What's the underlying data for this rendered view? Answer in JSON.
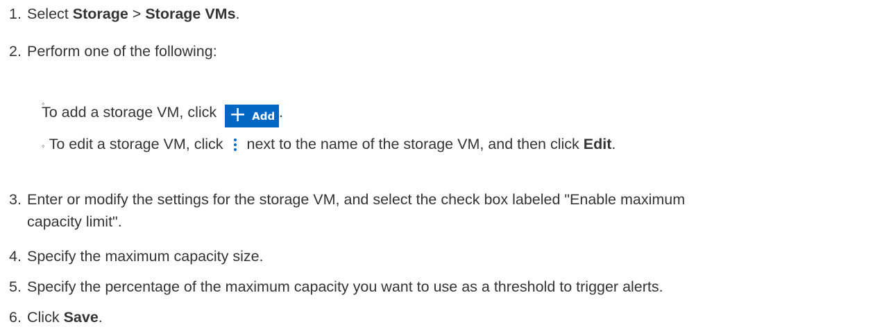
{
  "steps": [
    {
      "num": "1.",
      "pre": "Select ",
      "bold1": "Storage",
      "mid": " > ",
      "bold2": "Storage VMs",
      "post": "."
    },
    {
      "num": "2.",
      "text": "Perform one of the following:"
    },
    {
      "num": "3.",
      "line1": "Enter or modify the settings for the storage VM, and select the check box labeled \"Enable maximum",
      "line2": "capacity limit\"."
    },
    {
      "num": "4.",
      "text": "Specify the maximum capacity size."
    },
    {
      "num": "5.",
      "text": "Specify the percentage of the maximum capacity you want to use as a threshold to trigger alerts."
    },
    {
      "num": "6.",
      "pre": "Click ",
      "bold": "Save",
      "post": "."
    }
  ],
  "substeps": [
    {
      "bullet": "◦",
      "text": "To add a storage VM, click",
      "button": {
        "icon": "plus-icon",
        "label": "Add"
      },
      "post": "."
    },
    {
      "bullet": "◦",
      "pre": "To edit a storage VM, click",
      "icon": "kebab-menu-icon",
      "mid": "next to the name of the storage VM, and then click ",
      "bold": "Edit",
      "post": "."
    }
  ],
  "colors": {
    "text": "#333333",
    "accent": "#0067c5"
  }
}
